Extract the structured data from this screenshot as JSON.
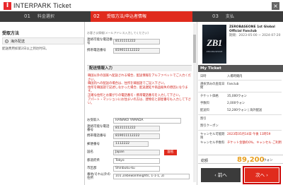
{
  "header": {
    "brand": "INTERPARK Ticket",
    "logo": "I",
    "close": "×"
  },
  "steps": [
    {
      "n": "01",
      "label": "料金選択"
    },
    {
      "n": "02",
      "label": "受取方法/申込者情報"
    },
    {
      "n": "03",
      "label": "支払"
    }
  ],
  "left": {
    "title": "受取方法",
    "option": "海外配送",
    "note": "配送费用如第2日以上到达时日。"
  },
  "form": {
    "intro": "お客さま情報(メールアドレス入力してください)",
    "top_rows": [
      {
        "label": "連絡可能な電話番号",
        "value": "8131111222"
      },
      {
        "label": "携帯電話番号",
        "value": "819011112222"
      }
    ],
    "section": "配送情報入力",
    "warning": "韓国以外の国家へ配送される場合、配送情報をアルファベットでご入力ください。\n韓国内への配送の場合は、住所を韓国語でご記入下さい。\n住所を韓国語で記述しなかった場合、配送遅延や商品紛失の原因になります。\n正確な住所とお繋がりの電話番号・携帯電話番号を入力して下さい。\nアパート・マンションにお住まいの方は、建物名と部屋番号も入力して下さい。",
    "rows": [
      {
        "label": "お受取人",
        "value": "HANAKO YAMADA"
      },
      {
        "label": "連絡可能な電話番号",
        "value": "8131111222"
      },
      {
        "label": "携帯電話番号",
        "value": "819011112222"
      },
      {
        "label": "郵便番号",
        "value": "1112222"
      },
      {
        "label": "国名",
        "value": "Japan",
        "button": "国名"
      },
      {
        "label": "都道府県",
        "value": "Tokyo"
      },
      {
        "label": "市区郡",
        "value": "Shinbuku-ku"
      },
      {
        "label": "番地/それ以外の住所",
        "value": "101 Zebewanheights, 1-1-1, Zi"
      }
    ]
  },
  "right": {
    "poster": {
      "logo": "ZB1",
      "sub": "ZEROBASEONE"
    },
    "info": {
      "title": "ZEROBASEONE 1st Global Official Fanclub",
      "date": "期間：2023-05-00 ~ 2024-07-20"
    },
    "title": "My Ticket",
    "rows": [
      {
        "k": "日時",
        "v": "入場時間内"
      },
      {
        "k": "選択済みの座席日間",
        "v": "Fanclub"
      },
      {
        "k": "チケット価格",
        "v": "35,000ウォン"
      },
      {
        "k": "手数料",
        "v": "2,000ウォン"
      },
      {
        "k": "配送料",
        "v": "52,200ウォン | 海外配送"
      },
      {
        "k": "割引",
        "v": ""
      },
      {
        "k": "割引クーポン",
        "v": ""
      },
      {
        "k": "キャンセル可能期限",
        "v": "2023年05月14日 午後 11時59"
      },
      {
        "k": "キャンセル手数料",
        "v": "チケット金額の0%、キャンセル ご利用"
      }
    ],
    "total_label": "総額",
    "total_value": "89,200",
    "total_unit": "ウォン",
    "prev": "前へ",
    "next": "次へ"
  },
  "colors": {
    "accent": "#e02b1d",
    "dark": "#3b3b3b",
    "total": "#e8a020"
  }
}
